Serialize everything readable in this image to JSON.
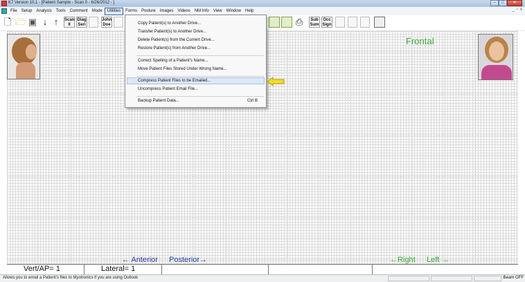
{
  "window": {
    "title": "K7 Version 10.1 - [Patient Sample - Scan 0 - 6/26/2012 - ]",
    "controls": [
      "–",
      "□",
      "✕"
    ]
  },
  "menubar": {
    "items": [
      "File",
      "Setup",
      "Analysis",
      "Tools",
      "Comment",
      "Mode",
      "Utilities",
      "Forms",
      "Posture",
      "Images",
      "Videos",
      "NM Info",
      "View",
      "Window",
      "Help"
    ],
    "active": "Utilities"
  },
  "toolbar": {
    "scan_label": "Scan II",
    "diag_label": "Diag Seri",
    "john_doe_label": "John Doe",
    "sub_sum_label": "Sub Sum",
    "occ_sign_label": "Occ Sign"
  },
  "utilities_menu": {
    "items": [
      "Copy Patient(s) to Another Drive...",
      "Transfer Patient(s) to Another Drive...",
      "Delete Patient(s) from the Current Drive...",
      "Restore Patient(s) from Another Drive...",
      "Correct Spelling of a Patient's Name...",
      "Move Patient Files Stored Under Wrong Name...",
      "Compress Patient Files to be Emailed...",
      "Uncompress Patient Email File...",
      "Backup Patient Data..."
    ],
    "highlighted_index": 6,
    "backup_shortcut": "Ctrl B"
  },
  "view": {
    "frontal_label": "Frontal",
    "anterior_label": "← Anterior",
    "posterior_label": "Posterior→",
    "right_label": "←Right",
    "left_label": "Left →",
    "vert_ap": "Vert/AP= 1",
    "lateral": "Lateral= 1"
  },
  "statusbar": {
    "message": "Allows you to email a Patient's files to Myotronics if you are using Outlook",
    "beam": "Beam OFF"
  },
  "colors": {
    "accent_green": "#38a838",
    "view_label_blue": "#2a3f9e",
    "pointer_arrow": "#e8d21a"
  }
}
